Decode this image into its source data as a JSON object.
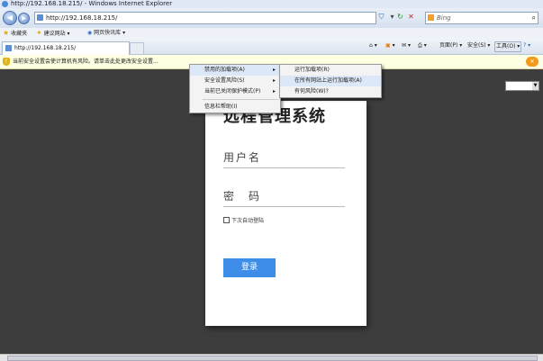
{
  "window": {
    "title": "http://192.168.18.215/ - Windows Internet Explorer"
  },
  "address": {
    "url": "http://192.168.18.215/"
  },
  "search": {
    "placeholder": "Bing"
  },
  "favorites": {
    "favorites_label": "收藏夹",
    "suggested_label": "建议网站 ▾",
    "webslice_label": "网页快讯库 ▾"
  },
  "tab": {
    "title": "http://192.168.18.215/"
  },
  "commandbar": {
    "page_label": "页面(P) ▾",
    "safety_label": "安全(S) ▾",
    "tools_label": "工具(O) ▾",
    "help_label": "? ▾"
  },
  "infobar": {
    "text": "当前安全设置会使计算机有风险。请单击此处更改安全设置..."
  },
  "context_menu": {
    "items": [
      {
        "label": "禁用的加载项(A)",
        "arrow": "▸"
      },
      {
        "label": "安全设置风险(S)",
        "arrow": "▸"
      },
      {
        "label": "当前已关闭保护模式(P)",
        "arrow": "▸"
      },
      {
        "label": "信息栏帮助(I)",
        "arrow": ""
      }
    ],
    "submenu": [
      {
        "label": "运行加载项(R)"
      },
      {
        "label": "在所有网站上运行加载项(A)"
      },
      {
        "label": "有何风险(W)?"
      }
    ]
  },
  "login": {
    "title": "远程管理系统",
    "username_placeholder": "用户名",
    "password_placeholder": "密　码",
    "remember_label": "下次自动登陆",
    "login_button": "登录"
  },
  "colors": {
    "accent": "#3e8ee9",
    "page_bg": "#3d3d3d",
    "infobar_bg": "#ffffe1"
  }
}
